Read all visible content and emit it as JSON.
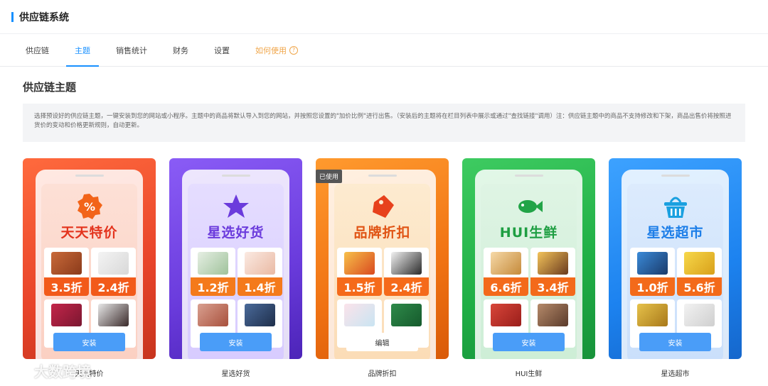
{
  "header": {
    "title": "供应链系统"
  },
  "tabs": [
    {
      "label": "供应链"
    },
    {
      "label": "主题"
    },
    {
      "label": "销售统计"
    },
    {
      "label": "财务"
    },
    {
      "label": "设置"
    },
    {
      "label": "如何使用"
    }
  ],
  "active_tab": "主题",
  "help_icon": "?",
  "section": {
    "title": "供应链主题",
    "description": "选择预设好的供应链主题，一键安装到您的网站或小程序。主题中的商品将默认导入到您的网站，并按照您设置的\"加价比例\"进行出售。（安装后的主题将在栏目列表中展示或通过\"查找链接\"调用）注：供应链主题中的商品不支持修改和下架，商品出售价将按照进货价的变动和价格更新规则，自动更新。"
  },
  "themes": [
    {
      "name": "天天特价",
      "caption": "天天特价",
      "discounts": [
        "3.5折",
        "2.4折"
      ],
      "button": "安装",
      "icon": "percent-badge-icon",
      "accent": "#e8442a"
    },
    {
      "name": "星选好货",
      "caption": "星选好货",
      "discounts": [
        "1.2折",
        "1.4折"
      ],
      "button": "安装",
      "icon": "star-icon",
      "accent": "#6a3bdc"
    },
    {
      "name": "品牌折扣",
      "caption": "品牌折扣",
      "discounts": [
        "1.5折",
        "2.4折"
      ],
      "button": "编辑",
      "badge": "已使用",
      "icon": "price-tag-icon",
      "accent": "#f07213"
    },
    {
      "name": "HUI生鲜",
      "caption": "HUI生鲜",
      "discounts": [
        "6.6折",
        "3.4折"
      ],
      "button": "安装",
      "icon": "fish-icon",
      "accent": "#1fae45"
    },
    {
      "name": "星选超市",
      "caption": "星选超市",
      "discounts": [
        "1.0折",
        "5.6折"
      ],
      "button": "安装",
      "icon": "basket-icon",
      "accent": "#1c82ef"
    }
  ],
  "watermark": {
    "text": "大数跨境"
  }
}
